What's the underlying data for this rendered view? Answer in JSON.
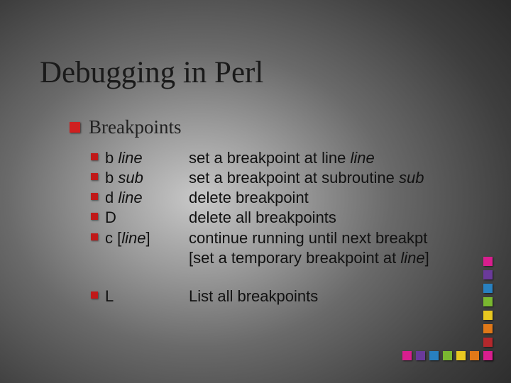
{
  "title": "Debugging in Perl",
  "section": {
    "heading": "Breakpoints",
    "items": [
      {
        "cmd_pre": "b  ",
        "cmd_ital": "line",
        "cmd_post": "",
        "desc_pre": "set a breakpoint at line ",
        "desc_ital": "line",
        "desc_post": ""
      },
      {
        "cmd_pre": "b  ",
        "cmd_ital": "sub",
        "cmd_post": "",
        "desc_pre": "set a breakpoint at subroutine ",
        "desc_ital": "sub",
        "desc_post": ""
      },
      {
        "cmd_pre": "d ",
        "cmd_ital": "line",
        "cmd_post": "",
        "desc_pre": "delete breakpoint",
        "desc_ital": "",
        "desc_post": ""
      },
      {
        "cmd_pre": "D",
        "cmd_ital": "",
        "cmd_post": "",
        "desc_pre": "delete all breakpoints",
        "desc_ital": "",
        "desc_post": ""
      },
      {
        "cmd_pre": "c  [",
        "cmd_ital": "line",
        "cmd_post": "]",
        "desc_pre": "continue running until next breakpt [set a temporary breakpoint at ",
        "desc_ital": "line",
        "desc_post": "]"
      },
      {
        "cmd_pre": "L",
        "cmd_ital": "",
        "cmd_post": "",
        "desc_pre": "List all breakpoints",
        "desc_ital": "",
        "desc_post": ""
      }
    ]
  },
  "decoration": {
    "colors": [
      "#d81e8e",
      "#b4282c",
      "#e07818",
      "#e8c820",
      "#7ab830",
      "#2880c0",
      "#6a3a9a",
      "#d81e8e"
    ]
  }
}
